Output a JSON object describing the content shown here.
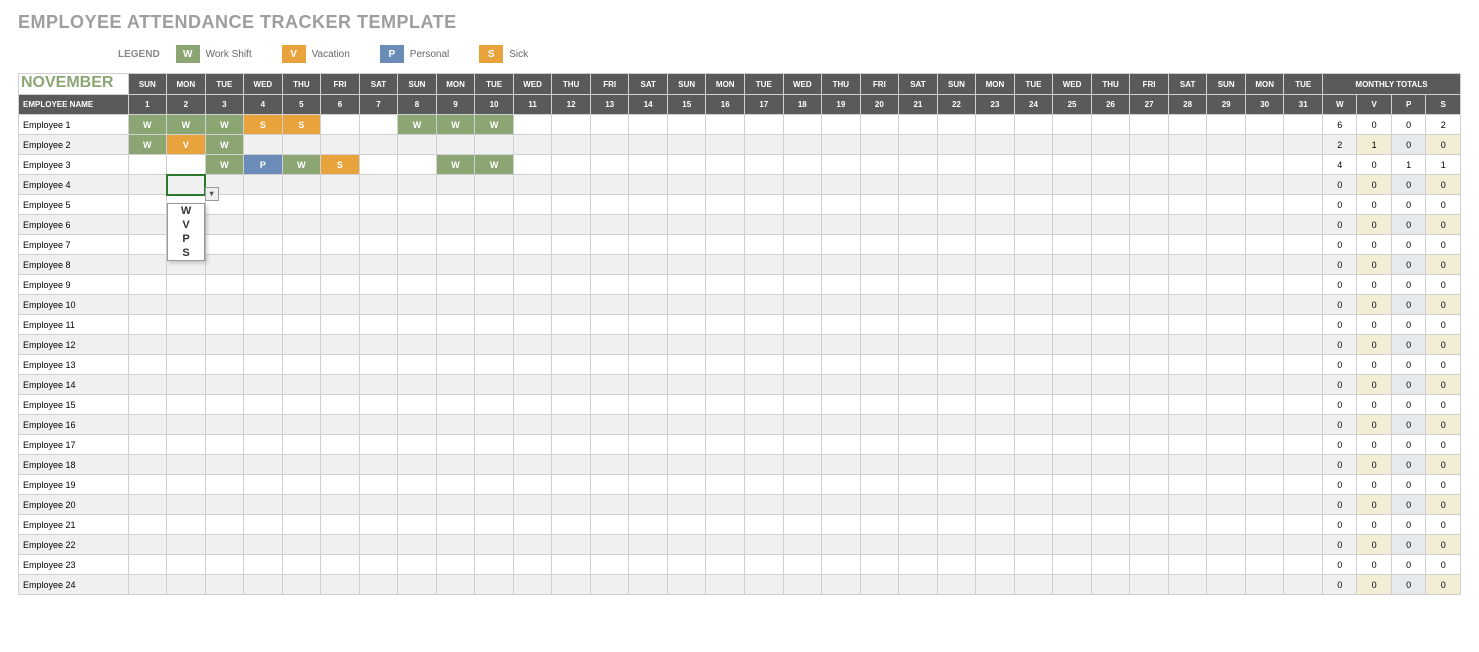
{
  "title": "EMPLOYEE ATTENDANCE TRACKER TEMPLATE",
  "legend": {
    "label": "LEGEND",
    "items": [
      {
        "code": "W",
        "text": "Work Shift",
        "cls": "sw-w"
      },
      {
        "code": "V",
        "text": "Vacation",
        "cls": "sw-v"
      },
      {
        "code": "P",
        "text": "Personal",
        "cls": "sw-p"
      },
      {
        "code": "S",
        "text": "Sick",
        "cls": "sw-s"
      }
    ]
  },
  "month": "NOVEMBER",
  "emp_header": "EMPLOYEE NAME",
  "totals_header": "MONTHLY TOTALS",
  "tot_cols": [
    "W",
    "V",
    "P",
    "S"
  ],
  "days_of_week": [
    "SUN",
    "MON",
    "TUE",
    "WED",
    "THU",
    "FRI",
    "SAT",
    "SUN",
    "MON",
    "TUE",
    "WED",
    "THU",
    "FRI",
    "SAT",
    "SUN",
    "MON",
    "TUE",
    "WED",
    "THU",
    "FRI",
    "SAT",
    "SUN",
    "MON",
    "TUE",
    "WED",
    "THU",
    "FRI",
    "SAT",
    "SUN",
    "MON",
    "TUE"
  ],
  "day_nums": [
    "1",
    "2",
    "3",
    "4",
    "5",
    "6",
    "7",
    "8",
    "9",
    "10",
    "11",
    "12",
    "13",
    "14",
    "15",
    "16",
    "17",
    "18",
    "19",
    "20",
    "21",
    "22",
    "23",
    "24",
    "25",
    "26",
    "27",
    "28",
    "29",
    "30",
    "31"
  ],
  "dropdown_options": [
    "W",
    "V",
    "P",
    "S"
  ],
  "employees": [
    {
      "name": "Employee 1",
      "cells": {
        "0": "W",
        "1": "W",
        "2": "W",
        "3": "S",
        "4": "S",
        "7": "W",
        "8": "W",
        "9": "W"
      },
      "tot": [
        6,
        0,
        0,
        2
      ]
    },
    {
      "name": "Employee 2",
      "cells": {
        "0": "W",
        "1": "V",
        "2": "W"
      },
      "tot": [
        2,
        1,
        0,
        0
      ]
    },
    {
      "name": "Employee 3",
      "cells": {
        "2": "W",
        "3": "P",
        "4": "W",
        "5": "S",
        "8": "W",
        "9": "W"
      },
      "tot": [
        4,
        0,
        1,
        1
      ]
    },
    {
      "name": "Employee 4",
      "cells": {},
      "tot": [
        0,
        0,
        0,
        0
      ],
      "dropdown": 1
    },
    {
      "name": "Employee 5",
      "cells": {},
      "tot": [
        0,
        0,
        0,
        0
      ]
    },
    {
      "name": "Employee 6",
      "cells": {},
      "tot": [
        0,
        0,
        0,
        0
      ]
    },
    {
      "name": "Employee 7",
      "cells": {},
      "tot": [
        0,
        0,
        0,
        0
      ]
    },
    {
      "name": "Employee 8",
      "cells": {},
      "tot": [
        0,
        0,
        0,
        0
      ]
    },
    {
      "name": "Employee 9",
      "cells": {},
      "tot": [
        0,
        0,
        0,
        0
      ]
    },
    {
      "name": "Employee 10",
      "cells": {},
      "tot": [
        0,
        0,
        0,
        0
      ]
    },
    {
      "name": "Employee 11",
      "cells": {},
      "tot": [
        0,
        0,
        0,
        0
      ]
    },
    {
      "name": "Employee 12",
      "cells": {},
      "tot": [
        0,
        0,
        0,
        0
      ]
    },
    {
      "name": "Employee 13",
      "cells": {},
      "tot": [
        0,
        0,
        0,
        0
      ]
    },
    {
      "name": "Employee 14",
      "cells": {},
      "tot": [
        0,
        0,
        0,
        0
      ]
    },
    {
      "name": "Employee 15",
      "cells": {},
      "tot": [
        0,
        0,
        0,
        0
      ]
    },
    {
      "name": "Employee 16",
      "cells": {},
      "tot": [
        0,
        0,
        0,
        0
      ]
    },
    {
      "name": "Employee 17",
      "cells": {},
      "tot": [
        0,
        0,
        0,
        0
      ]
    },
    {
      "name": "Employee 18",
      "cells": {},
      "tot": [
        0,
        0,
        0,
        0
      ]
    },
    {
      "name": "Employee 19",
      "cells": {},
      "tot": [
        0,
        0,
        0,
        0
      ]
    },
    {
      "name": "Employee 20",
      "cells": {},
      "tot": [
        0,
        0,
        0,
        0
      ]
    },
    {
      "name": "Employee 21",
      "cells": {},
      "tot": [
        0,
        0,
        0,
        0
      ]
    },
    {
      "name": "Employee 22",
      "cells": {},
      "tot": [
        0,
        0,
        0,
        0
      ]
    },
    {
      "name": "Employee 23",
      "cells": {},
      "tot": [
        0,
        0,
        0,
        0
      ]
    },
    {
      "name": "Employee 24",
      "cells": {},
      "tot": [
        0,
        0,
        0,
        0
      ]
    }
  ],
  "colors": {
    "W": "#8ba673",
    "V": "#e8a33d",
    "P": "#6b8cb8",
    "S": "#e8a33d"
  }
}
